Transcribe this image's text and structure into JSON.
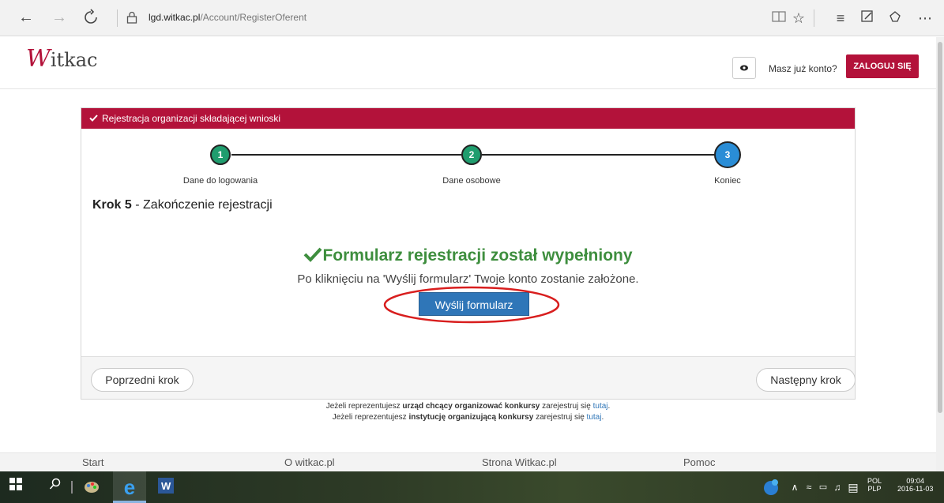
{
  "browser": {
    "url_domain": "lgd.witkac.pl",
    "url_path": "/Account/RegisterOferent"
  },
  "header": {
    "logo_first": "W",
    "logo_rest": "itkac",
    "already_have_account": "Masz już konto?",
    "login_button": "ZALOGUJ SIĘ"
  },
  "panel": {
    "title": "Rejestracja organizacji składającej wnioski",
    "steps": [
      {
        "number": "1",
        "label": "Dane do logowania",
        "state": "done"
      },
      {
        "number": "2",
        "label": "Dane osobowe",
        "state": "done"
      },
      {
        "number": "3",
        "label": "Koniec",
        "state": "active"
      }
    ],
    "step_title_bold": "Krok 5",
    "step_title_rest": " - Zakończenie rejestracji",
    "success_title": "Formularz rejestracji został wypełniony",
    "success_desc": "Po kliknięciu na 'Wyślij formularz' Twoje konto zostanie założone.",
    "send_button": "Wyślij formularz",
    "prev_button": "Poprzedni krok",
    "next_button": "Następny krok"
  },
  "info": {
    "line1_pre": "Jeżeli reprezentujesz ",
    "line1_bold": "urząd chcący organizować konkursy",
    "line1_mid": " zarejestruj się ",
    "line1_link": "tutaj",
    "line1_end": ".",
    "line2_pre": "Jeżeli reprezentujesz ",
    "line2_bold": "instytucję organizującą konkursy",
    "line2_mid": " zarejestruj się ",
    "line2_link": "tutaj",
    "line2_end": "."
  },
  "footer": {
    "links": [
      "Start",
      "O witkac.pl",
      "Strona Witkac.pl",
      "Pomoc"
    ]
  },
  "taskbar": {
    "lang1": "POL",
    "lang2": "PLP",
    "time": "09:04",
    "date": "2016-11-03"
  },
  "colors": {
    "brand": "#b3123a",
    "success": "#3e8e3e",
    "primary": "#2f76b8",
    "step_done": "#1f9d6e",
    "step_active": "#2a8dd6"
  }
}
